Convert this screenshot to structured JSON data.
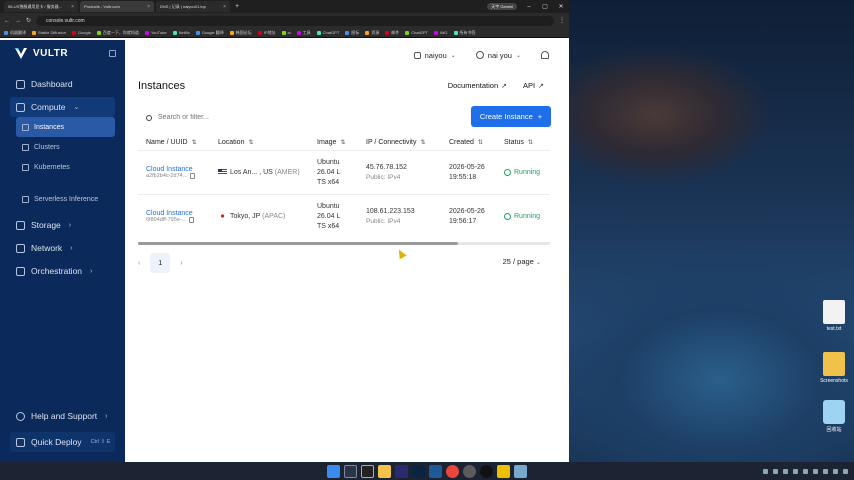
{
  "browser": {
    "tabs": [
      {
        "label": "58-US独服通用显卡 / 服务器..."
      },
      {
        "label": "Products - Vultr.com",
        "active": true
      },
      {
        "label": "DNS | 记录 | naiyou01.top"
      }
    ],
    "new_tab": "+",
    "profile": "天宇 Gemini",
    "url": "console.vultr.com",
    "bookmarks": [
      "机器翻译",
      "Stable Diffusion",
      "Google",
      "百度一下，你就知道",
      "YouTube",
      "Netflix",
      "Google 翻译",
      "韩国论坛",
      "IP地址",
      "ai",
      "工具",
      "ChatGPT",
      "图标",
      "资源",
      "邮件",
      "ChatGPT",
      "IMG",
      "所有书签"
    ]
  },
  "sidebar": {
    "brand": "VULTR",
    "items": [
      {
        "label": "Dashboard"
      },
      {
        "label": "Compute",
        "chevron": "⌄"
      },
      {
        "label": "Instances"
      },
      {
        "label": "Clusters"
      },
      {
        "label": "Kubernetes"
      },
      {
        "label": "Serverless Inference"
      },
      {
        "label": "Storage",
        "chevron": "›"
      },
      {
        "label": "Network",
        "chevron": "›"
      },
      {
        "label": "Orchestration",
        "chevron": "›"
      }
    ],
    "help": "Help and Support",
    "help_chevron": "›",
    "quick_deploy": "Quick Deploy",
    "quick_deploy_kbd": "Ctrl ⇧ E"
  },
  "topbar": {
    "team": "naiyou",
    "user": "nai you"
  },
  "main": {
    "title": "Instances",
    "documentation": "Documentation",
    "api": "API",
    "search_placeholder": "Search or filter...",
    "create_label": "Create Instance",
    "columns": [
      "Name / UUID",
      "Location",
      "Image",
      "IP / Connectivity",
      "Created",
      "Status"
    ],
    "rows": [
      {
        "name": "Cloud Instance",
        "uuid": "a2fb2b4c-2d74...",
        "location": "Los An... , US",
        "region": "(AMER)",
        "image": [
          "Ubuntu",
          "26.04 L",
          "TS x64"
        ],
        "ip": "45.76.78.152",
        "ip_sub": "Public: IPv4",
        "created_date": "2026-05-26",
        "created_time": "19:55:18",
        "status": "Running"
      },
      {
        "name": "Cloud Instance",
        "uuid": "6f804dff-795e-...",
        "location": "Tokyo, JP",
        "region": "(APAC)",
        "image": [
          "Ubuntu",
          "26.04 L",
          "TS x64"
        ],
        "ip": "108.61.223.153",
        "ip_sub": "Public: IPv4",
        "created_date": "2026-05-26",
        "created_time": "19:56:17",
        "status": "Running"
      }
    ],
    "page": "1",
    "per_page": "25 / page",
    "prev": "‹",
    "next": "›"
  },
  "desktop": {
    "icons": [
      {
        "label": "test.txt"
      },
      {
        "label": "Screenshots"
      },
      {
        "label": "回收站"
      }
    ]
  },
  "colors": {
    "sidebar": "#0b2a5b",
    "accent": "#1f6feb",
    "running": "#19a463"
  }
}
